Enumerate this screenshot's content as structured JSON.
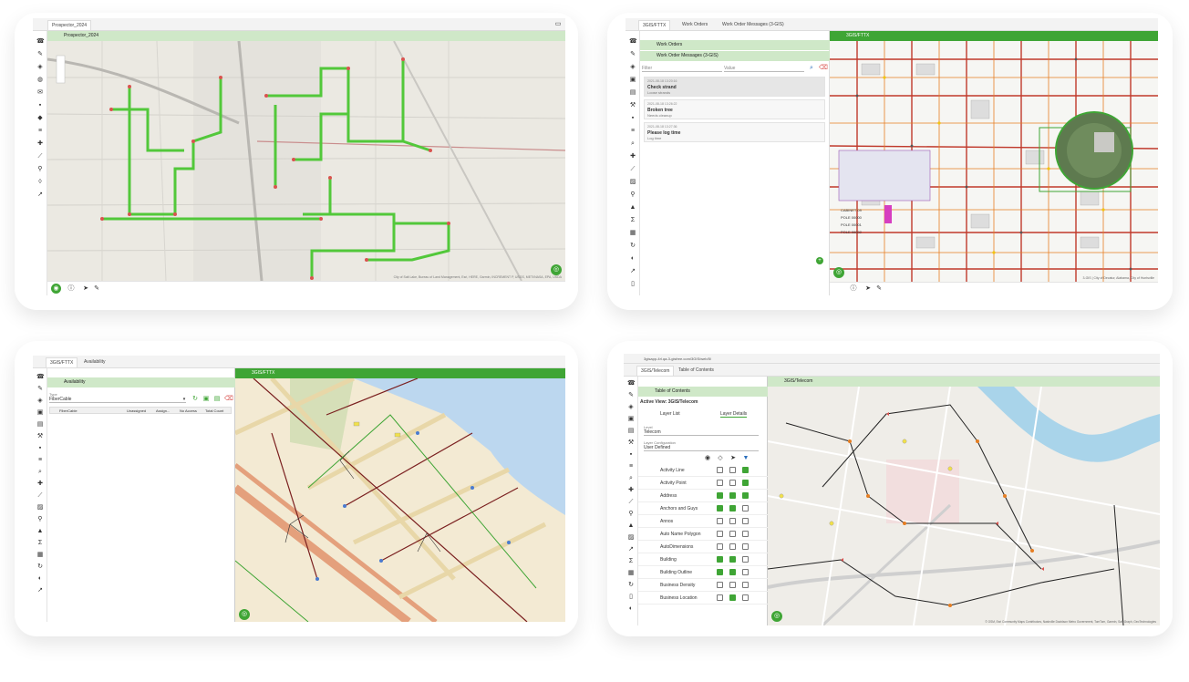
{
  "panel1": {
    "title": "Prospector_2024",
    "attribution": "City of Salt Lake, Bureau of Land Management, Esri, HERE, Garmin, INCREMENT P, USGS, METI/NASA, EPA, USDA"
  },
  "panel2": {
    "tabs": [
      "3GIS/FTTX",
      "Work Orders",
      "Work Order Messages (3-GIS)"
    ],
    "list_items": [
      "Work Orders",
      "Work Order Messages (3-GIS)"
    ],
    "filter_placeholder": "Filter",
    "value_placeholder": "Value",
    "messages": [
      {
        "meta": "2021-08-18 13:20:16",
        "title": "Check strand",
        "body": "Loose strands"
      },
      {
        "meta": "2021-08-18 13:26:22",
        "title": "Broken tree",
        "body": "Needs cleanup"
      },
      {
        "meta": "2021-08-18 13:27:36",
        "title": "Please log time",
        "body": "Log time"
      }
    ],
    "map_title": "3GIS/FTTX",
    "map_labels": [
      "CABINET 09",
      "POLE 00000",
      "POLE 00001",
      "POLE 00002"
    ],
    "attribution": "3-GIS | City of Decatur, Alabama, City of Huntsville"
  },
  "panel3": {
    "tabs": [
      "3GIS/FTTX",
      "Availability"
    ],
    "panel_title": "Availability",
    "type_label": "Type",
    "type_value": "FiberCable",
    "columns": [
      "FiberCable",
      "Unassigned",
      "Assign...",
      "No Access",
      "Total Count"
    ],
    "map_title": "3GIS/FTTX"
  },
  "panel4": {
    "url": "3gisapp-4rl.qa-3-gisfree.com/3GIS/web/5/",
    "tabs": [
      "3GIS/Telecom",
      "Table of Contents"
    ],
    "panel_title": "Table of Contents",
    "active_view": "Active View: 3GIS/Telecom",
    "subtabs": [
      "Layer List",
      "Layer Details"
    ],
    "level_label": "Level",
    "level_value": "Telecom",
    "layer_config_label": "Layer Configuration",
    "layer_config_value": "User Defined",
    "layers": [
      "Activity Line",
      "Activity Point",
      "Address",
      "Anchors and Guys",
      "Annos",
      "Auto Name Polygon",
      "AutoDimensions",
      "Building",
      "Building Outline",
      "Business Density",
      "Business Location"
    ],
    "map_title": "3GIS/Telecom",
    "attribution": "© OSM, Esri Community Maps Contributors, Nashville Davidson Metro Government, TomTom, Garmin, SafeGraph, GeoTechnologies"
  },
  "colors": {
    "brand_green": "#3fa535",
    "light_green": "#cfe8c8",
    "route_green": "#52c83a",
    "route_red": "#d9534f"
  }
}
